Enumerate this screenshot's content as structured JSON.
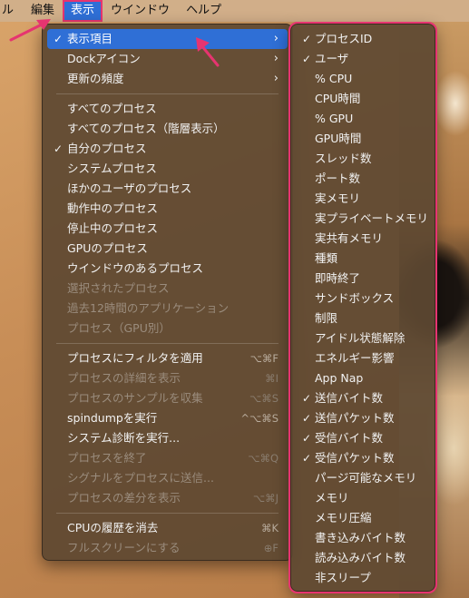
{
  "menubar": {
    "partial_item": "ル",
    "items": [
      "編集",
      "表示",
      "ウインドウ",
      "ヘルプ"
    ],
    "active_index": 1
  },
  "main_menu": {
    "groups": [
      [
        {
          "label": "表示項目",
          "checked": true,
          "submenu": true,
          "selected": true
        },
        {
          "label": "Dockアイコン",
          "submenu": true
        },
        {
          "label": "更新の頻度",
          "submenu": true
        }
      ],
      [
        {
          "label": "すべてのプロセス"
        },
        {
          "label": "すべてのプロセス（階層表示）"
        },
        {
          "label": "自分のプロセス",
          "checked": true
        },
        {
          "label": "システムプロセス"
        },
        {
          "label": "ほかのユーザのプロセス"
        },
        {
          "label": "動作中のプロセス"
        },
        {
          "label": "停止中のプロセス"
        },
        {
          "label": "GPUのプロセス"
        },
        {
          "label": "ウインドウのあるプロセス"
        },
        {
          "label": "選択されたプロセス",
          "disabled": true
        },
        {
          "label": "過去12時間のアプリケーション",
          "disabled": true
        },
        {
          "label": "プロセス（GPU別）",
          "disabled": true
        }
      ],
      [
        {
          "label": "プロセスにフィルタを適用",
          "shortcut": "⌥⌘F"
        },
        {
          "label": "プロセスの詳細を表示",
          "shortcut": "⌘I",
          "disabled": true
        },
        {
          "label": "プロセスのサンプルを収集",
          "shortcut": "⌥⌘S",
          "disabled": true
        },
        {
          "label": "spindumpを実行",
          "shortcut": "^⌥⌘S"
        },
        {
          "label": "システム診断を実行..."
        },
        {
          "label": "プロセスを終了",
          "shortcut": "⌥⌘Q",
          "disabled": true
        },
        {
          "label": "シグナルをプロセスに送信...",
          "disabled": true
        },
        {
          "label": "プロセスの差分を表示",
          "shortcut": "⌥⌘J",
          "disabled": true
        }
      ],
      [
        {
          "label": "CPUの履歴を消去",
          "shortcut": "⌘K"
        },
        {
          "label": "フルスクリーンにする",
          "shortcut": "⊕F",
          "disabled": true
        }
      ]
    ]
  },
  "sub_menu": {
    "items": [
      {
        "label": "プロセスID",
        "checked": true
      },
      {
        "label": "ユーザ",
        "checked": true
      },
      {
        "label": "% CPU"
      },
      {
        "label": "CPU時間"
      },
      {
        "label": "% GPU"
      },
      {
        "label": "GPU時間"
      },
      {
        "label": "スレッド数"
      },
      {
        "label": "ポート数"
      },
      {
        "label": "実メモリ"
      },
      {
        "label": "実プライベートメモリ"
      },
      {
        "label": "実共有メモリ"
      },
      {
        "label": "種類"
      },
      {
        "label": "即時終了"
      },
      {
        "label": "サンドボックス"
      },
      {
        "label": "制限"
      },
      {
        "label": "アイドル状態解除"
      },
      {
        "label": "エネルギー影響"
      },
      {
        "label": "App Nap"
      },
      {
        "label": "送信バイト数",
        "checked": true
      },
      {
        "label": "送信パケット数",
        "checked": true
      },
      {
        "label": "受信バイト数",
        "checked": true
      },
      {
        "label": "受信パケット数",
        "checked": true
      },
      {
        "label": "パージ可能なメモリ"
      },
      {
        "label": "メモリ"
      },
      {
        "label": "メモリ圧縮"
      },
      {
        "label": "書き込みバイト数"
      },
      {
        "label": "読み込みバイト数"
      },
      {
        "label": "非スリープ"
      }
    ]
  },
  "icons": {
    "check": "checkmark-icon",
    "arrow": "chevron-right-icon"
  },
  "colors": {
    "highlight": "#2f6fd6",
    "annotation": "#e63470"
  }
}
